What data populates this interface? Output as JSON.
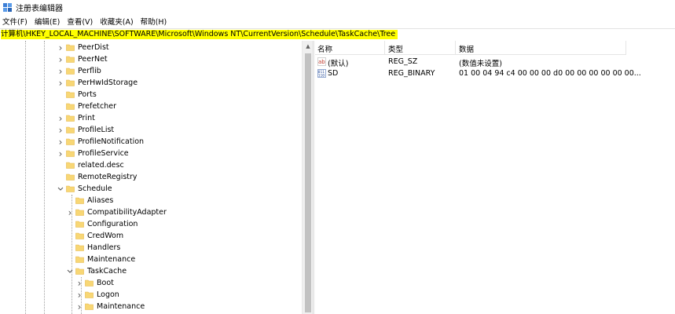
{
  "window": {
    "title": "注册表编辑器"
  },
  "menu": [
    "文件(F)",
    "编辑(E)",
    "查看(V)",
    "收藏夹(A)",
    "帮助(H)"
  ],
  "address": "计算机\\HKEY_LOCAL_MACHINE\\SOFTWARE\\Microsoft\\Windows NT\\CurrentVersion\\Schedule\\TaskCache\\Tree",
  "tree": [
    {
      "label": "PeerDist",
      "depth": 0,
      "expander": "collapsed"
    },
    {
      "label": "PeerNet",
      "depth": 0,
      "expander": "collapsed"
    },
    {
      "label": "Perflib",
      "depth": 0,
      "expander": "collapsed"
    },
    {
      "label": "PerHwIdStorage",
      "depth": 0,
      "expander": "collapsed"
    },
    {
      "label": "Ports",
      "depth": 0,
      "expander": "none"
    },
    {
      "label": "Prefetcher",
      "depth": 0,
      "expander": "none"
    },
    {
      "label": "Print",
      "depth": 0,
      "expander": "collapsed"
    },
    {
      "label": "ProfileList",
      "depth": 0,
      "expander": "collapsed"
    },
    {
      "label": "ProfileNotification",
      "depth": 0,
      "expander": "collapsed"
    },
    {
      "label": "ProfileService",
      "depth": 0,
      "expander": "collapsed"
    },
    {
      "label": "related.desc",
      "depth": 0,
      "expander": "none"
    },
    {
      "label": "RemoteRegistry",
      "depth": 0,
      "expander": "none"
    },
    {
      "label": "Schedule",
      "depth": 0,
      "expander": "expanded"
    },
    {
      "label": "Aliases",
      "depth": 1,
      "expander": "none"
    },
    {
      "label": "CompatibilityAdapter",
      "depth": 1,
      "expander": "collapsed"
    },
    {
      "label": "Configuration",
      "depth": 1,
      "expander": "none"
    },
    {
      "label": "CredWom",
      "depth": 1,
      "expander": "none"
    },
    {
      "label": "Handlers",
      "depth": 1,
      "expander": "none"
    },
    {
      "label": "Maintenance",
      "depth": 1,
      "expander": "none"
    },
    {
      "label": "TaskCache",
      "depth": 1,
      "expander": "expanded"
    },
    {
      "label": "Boot",
      "depth": 2,
      "expander": "collapsed"
    },
    {
      "label": "Logon",
      "depth": 2,
      "expander": "collapsed"
    },
    {
      "label": "Maintenance",
      "depth": 2,
      "expander": "collapsed"
    }
  ],
  "columns": {
    "name": "名称",
    "type": "类型",
    "data": "数据"
  },
  "values": [
    {
      "icon": "string-value-icon",
      "name": "(默认)",
      "type": "REG_SZ",
      "data": "(数值未设置)"
    },
    {
      "icon": "binary-value-icon",
      "name": "SD",
      "type": "REG_BINARY",
      "data": "01 00 04 94 c4 00 00 00 d0 00 00 00 00 00 00..."
    }
  ],
  "colors": {
    "address_highlight": "#ffff00",
    "folder": "#f8d775",
    "folder_edge": "#e6b84a"
  }
}
